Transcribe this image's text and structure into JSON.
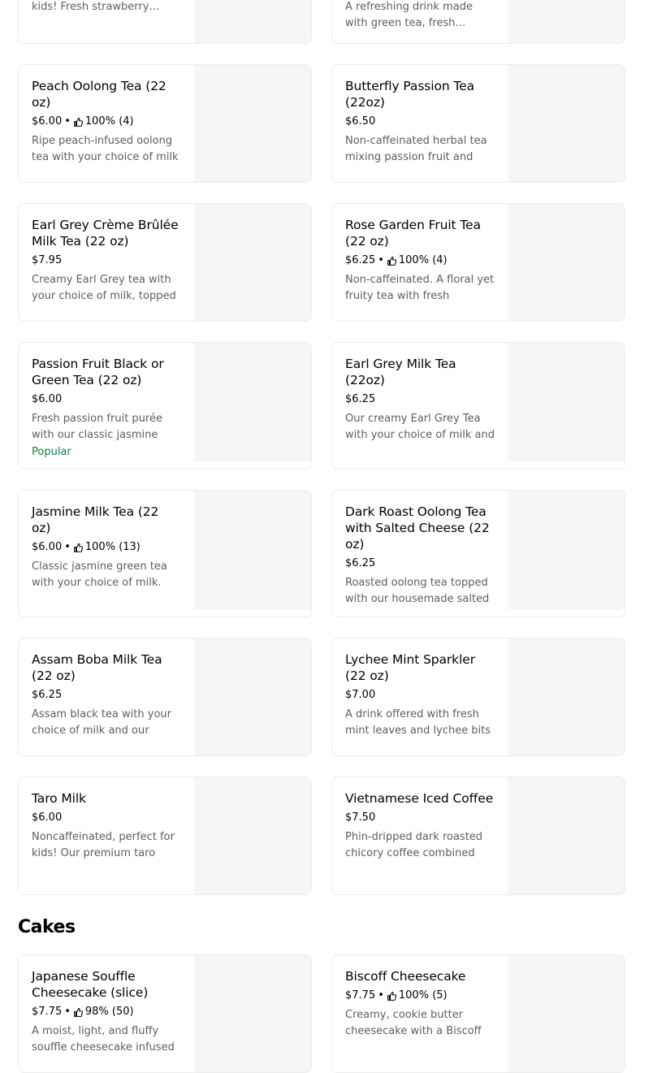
{
  "top_partial": [
    {
      "desc": "kids! Fresh strawberry purée"
    },
    {
      "desc": "A refreshing drink made with green tea, fresh strawberry,"
    }
  ],
  "items": [
    {
      "name": "Peach Oolong Tea (22 oz)",
      "price": "$6.00",
      "rating": "100% (4)",
      "desc": "Ripe peach-infused oolong tea with your choice of milk"
    },
    {
      "name": "Butterfly Passion Tea (22oz)",
      "price": "$6.50",
      "rating": "",
      "desc": "Non-caffeinated herbal tea mixing passion fruit and"
    },
    {
      "name": "Earl Grey Crème Brûlée Milk Tea (22 oz)",
      "price": "$7.95",
      "rating": "",
      "desc": "Creamy Earl Grey tea with your choice of milk, topped"
    },
    {
      "name": "Rose Garden Fruit Tea (22 oz)",
      "price": "$6.25",
      "rating": "100% (4)",
      "desc": "Non-caffeinated. A floral yet fruity tea with fresh"
    },
    {
      "name": "Passion Fruit Black or Green Tea (22 oz)",
      "price": "$6.00",
      "rating": "",
      "desc": "Fresh passion fruit purée with our classic jasmine",
      "badge": "Popular"
    },
    {
      "name": "Earl Grey Milk Tea (22oz)",
      "price": "$6.25",
      "rating": "",
      "desc": "Our creamy Earl Grey Tea with your choice of milk and"
    },
    {
      "name": "Jasmine Milk Tea (22 oz)",
      "price": "$6.00",
      "rating": "100% (13)",
      "desc": "Classic jasmine green tea with your choice of milk."
    },
    {
      "name": "Dark Roast Oolong Tea with Salted Cheese (22 oz)",
      "price": "$6.25",
      "rating": "",
      "desc": "Roasted oolong tea topped with our housemade salted"
    },
    {
      "name": "Assam Boba Milk Tea (22 oz)",
      "price": "$6.25",
      "rating": "",
      "desc": "Assam black tea with your choice of milk and our"
    },
    {
      "name": "Lychee Mint Sparkler (22 oz)",
      "price": "$7.00",
      "rating": "",
      "desc": "A drink offered with fresh mint leaves and lychee bits"
    },
    {
      "name": "Taro Milk",
      "price": "$6.00",
      "rating": "",
      "desc": "Noncaffeinated, perfect for kids! Our premium taro"
    },
    {
      "name": "Vietnamese Iced Coffee",
      "price": "$7.50",
      "rating": "",
      "desc": "Phin-dripped dark roasted chicory coffee combined"
    }
  ],
  "cakes_section": {
    "title": "Cakes",
    "items": [
      {
        "name": "Japanese Souffle Cheesecake (slice)",
        "price": "$7.75",
        "rating": "98% (50)",
        "desc": "A moist, light, and fluffy souffle cheesecake infused"
      },
      {
        "name": "Biscoff Cheesecake",
        "price": "$7.75",
        "rating": "100% (5)",
        "desc": "Creamy, cookie butter cheesecake with a Biscoff"
      }
    ]
  },
  "dot": "•",
  "icon": "thumbs-up-icon"
}
